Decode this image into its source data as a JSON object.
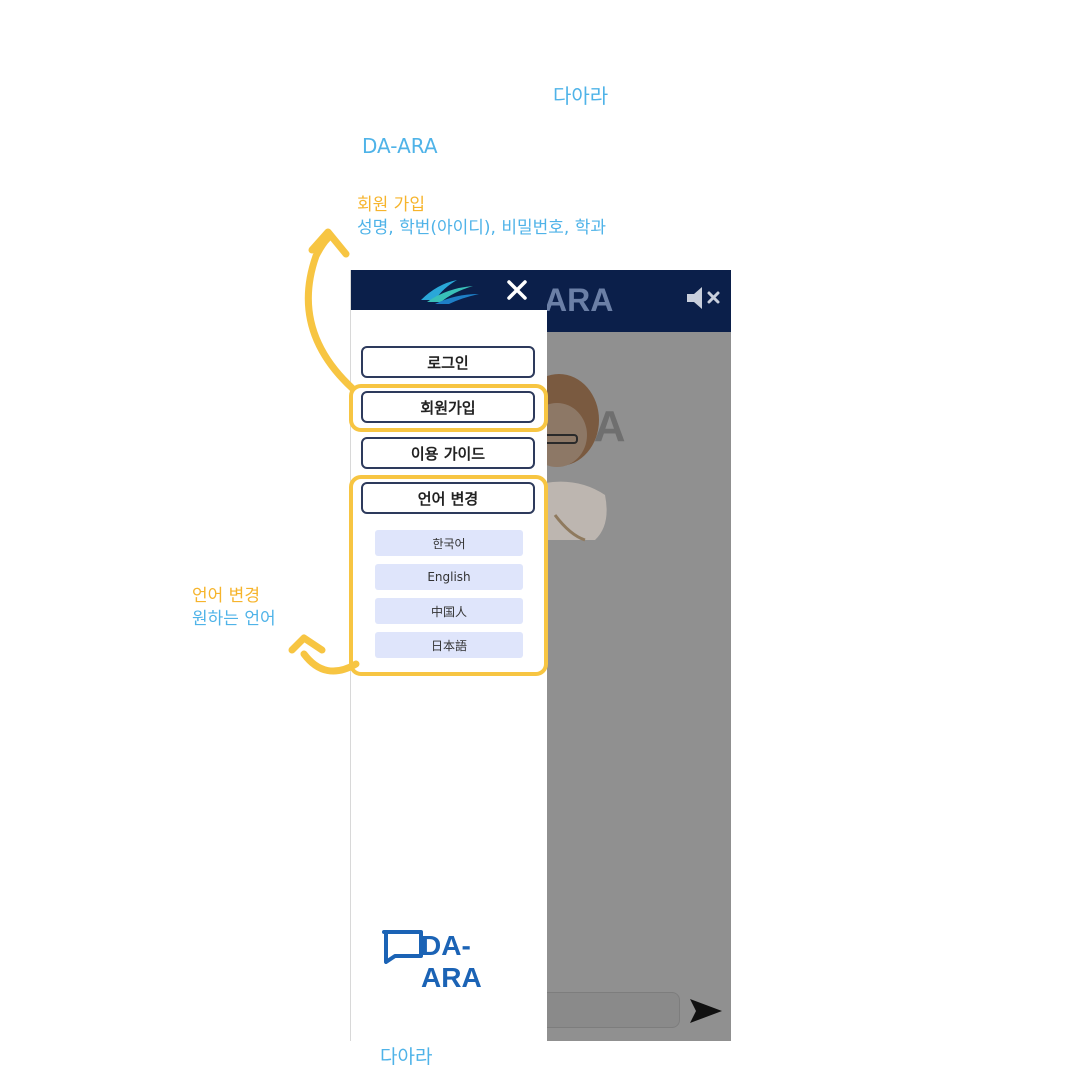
{
  "annotations": {
    "top_title": "다아라",
    "brand_en": "DA-ARA",
    "signup_title": "회원 가입",
    "signup_desc": "성명, 학번(아이디), 비밀번호, 학과",
    "language_title": "언어 변경",
    "language_desc": "원하는 언어",
    "bottom_title": "다아라"
  },
  "app": {
    "header_brand": "ARA",
    "header_brand_small": "",
    "watermark": "RA",
    "drawer": {
      "menu": {
        "login": "로그인",
        "signup": "회원가입",
        "guide": "이용 가이드",
        "language": "언어 변경"
      },
      "languages": [
        "한국어",
        "English",
        "中国人",
        "日本語"
      ],
      "footer_logo": "DA-ARA"
    },
    "icons": {
      "close": "close-icon",
      "mute": "volume-mute-icon",
      "send": "send-icon",
      "logo": "wave-logo-icon"
    }
  },
  "colors": {
    "navy": "#0b1f4a",
    "highlight": "#f7c542",
    "annotation_blue": "#4fb3e8",
    "annotation_yellow": "#f6b42c",
    "language_option_bg": "#dfe5fb",
    "logo_blue": "#1b63b5"
  }
}
